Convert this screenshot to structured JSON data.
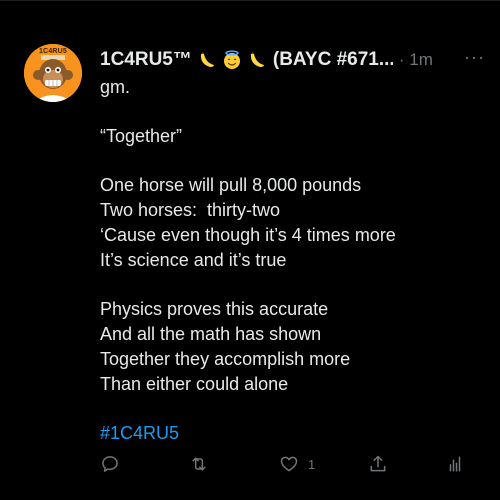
{
  "tweet": {
    "avatar_label": "1C4RU5",
    "display_name": "1C4RU5™",
    "name_suffix": "(BAYC #671...",
    "dot_time": "· 1m",
    "more_label": "···",
    "lines": {
      "l1": "gm.",
      "l2": "“Together”",
      "l3": "One horse will pull 8,000 pounds",
      "l4": "Two horses:  thirty-two",
      "l5": "‘Cause even though it’s 4 times more",
      "l6": "It’s science and it’s true",
      "l7": "Physics proves this accurate",
      "l8": "And all the math has shown",
      "l9": "Together they accomplish more",
      "l10": "Than either could alone"
    },
    "hashtag": "#1C4RU5",
    "like_count": "1",
    "emojis": [
      "banana-emoji",
      "halo-smile-emoji",
      "banana-emoji"
    ]
  },
  "colors": {
    "background": "#000000",
    "text": "#e7e9ea",
    "muted": "#71767b",
    "link": "#1d9bf0",
    "avatar_bg": "#f7931e"
  }
}
